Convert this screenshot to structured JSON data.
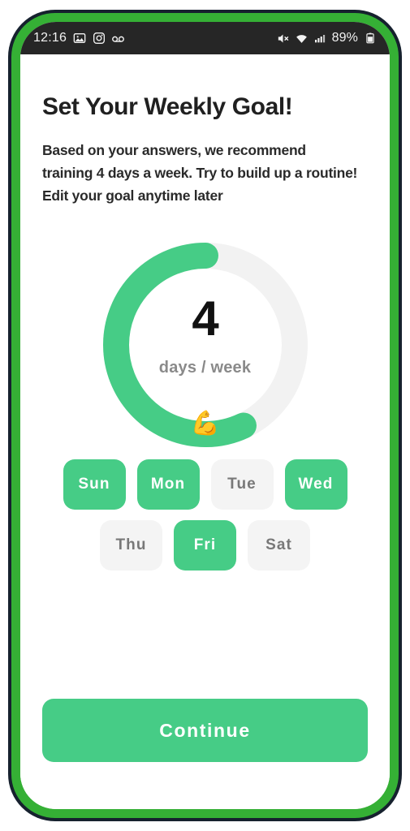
{
  "status_bar": {
    "time": "12:16",
    "battery_percent": "89%",
    "left_icons": [
      "photos-icon",
      "instagram-icon",
      "voicemail-icon"
    ],
    "right_icons": [
      "mute-icon",
      "wifi-icon",
      "cellular-signal-icon",
      "battery-icon"
    ]
  },
  "screen": {
    "title": "Set Your Weekly Goal!",
    "subtitle": "Based on your answers, we recommend training 4 days a week. Try to build up a routine! Edit your goal anytime later"
  },
  "goal_ring": {
    "value": "4",
    "unit": "days / week",
    "emoji": "💪",
    "total": 7,
    "percent_complete": 57,
    "track_color": "#f2f2f2",
    "progress_color": "#46cc86"
  },
  "day_selector": {
    "rows": [
      [
        {
          "label": "Sun",
          "selected": true
        },
        {
          "label": "Mon",
          "selected": true
        },
        {
          "label": "Tue",
          "selected": false
        },
        {
          "label": "Wed",
          "selected": true
        }
      ],
      [
        {
          "label": "Thu",
          "selected": false
        },
        {
          "label": "Fri",
          "selected": true
        },
        {
          "label": "Sat",
          "selected": false
        }
      ]
    ]
  },
  "footer": {
    "continue_label": "Continue"
  },
  "theme": {
    "accent": "#46cc86",
    "frame_green": "#35b035",
    "frame_dark": "#16212e",
    "chip_inactive_bg": "#f4f4f4",
    "chip_inactive_text": "#787878"
  }
}
